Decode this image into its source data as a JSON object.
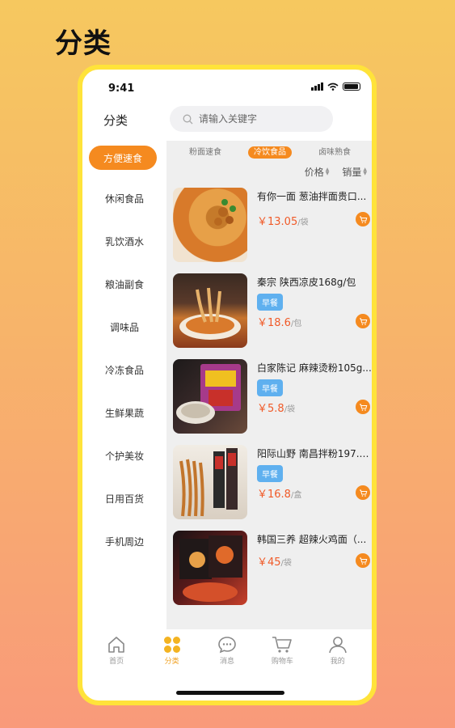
{
  "promo": {
    "title": "分类"
  },
  "status": {
    "time": "9:41"
  },
  "header": {
    "title": "分类",
    "search_placeholder": "请输入关键字"
  },
  "sidebar": {
    "items": [
      {
        "label": "方便速食",
        "active": true
      },
      {
        "label": "休闲食品"
      },
      {
        "label": "乳饮酒水"
      },
      {
        "label": "粮油副食"
      },
      {
        "label": "调味品"
      },
      {
        "label": "冷冻食品"
      },
      {
        "label": "生鲜果蔬"
      },
      {
        "label": "个护美妆"
      },
      {
        "label": "日用百货"
      },
      {
        "label": "手机周边"
      }
    ]
  },
  "subtabs": [
    {
      "label": "粉面速食"
    },
    {
      "label": "冷饮食品",
      "active": true
    },
    {
      "label": "卤味熟食"
    }
  ],
  "sorts": {
    "price": "价格",
    "sales": "销量"
  },
  "products": [
    {
      "name": "有你一面 葱油拌面贵口...",
      "tag": "",
      "price": "￥13.05",
      "unit": "/袋"
    },
    {
      "name": "秦宗 陕西凉皮168g/包",
      "tag": "早餐",
      "price": "￥18.6",
      "unit": "/包"
    },
    {
      "name": "白家陈记 麻辣烫粉105g...",
      "tag": "早餐",
      "price": "￥5.8",
      "unit": "/袋"
    },
    {
      "name": "阳际山野 南昌拌粉197.8...",
      "tag": "早餐",
      "price": "￥16.8",
      "unit": "/盒"
    },
    {
      "name": "韩国三养 超辣火鸡面（...",
      "tag": "",
      "price": "￥45",
      "unit": "/袋"
    }
  ],
  "tabbar": {
    "items": [
      {
        "label": "首页",
        "icon": "home-icon"
      },
      {
        "label": "分类",
        "icon": "category-icon",
        "active": true
      },
      {
        "label": "消息",
        "icon": "message-icon"
      },
      {
        "label": "购物车",
        "icon": "cart-icon"
      },
      {
        "label": "我的",
        "icon": "profile-icon"
      }
    ]
  },
  "colors": {
    "accent": "#f58a1f",
    "price": "#f05a28",
    "tag": "#5fb0ef",
    "frame": "#ffe33a"
  }
}
